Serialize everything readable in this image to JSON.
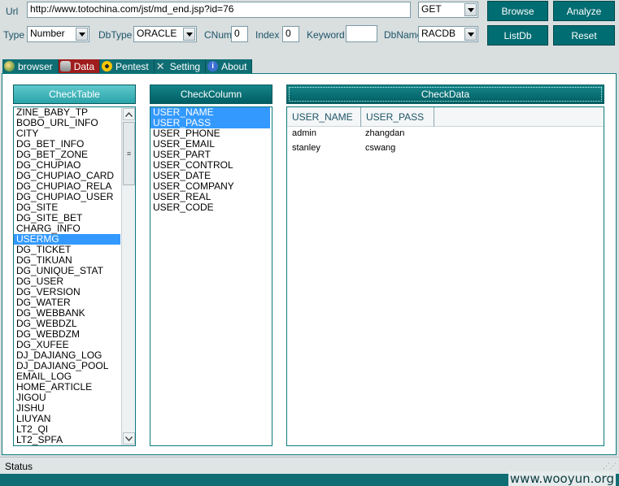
{
  "toolbar": {
    "url_label": "Url",
    "url_value": "http://www.totochina.com/jst/md_end.jsp?id=76",
    "method_value": "GET",
    "browse_label": "Browse",
    "analyze_label": "Analyze",
    "listdb_label": "ListDb",
    "reset_label": "Reset",
    "type_label": "Type",
    "type_value": "Number",
    "dbtype_label": "DbType",
    "dbtype_value": "ORACLE",
    "cnum_label": "CNum",
    "cnum_value": "0",
    "index_label": "Index",
    "index_value": "0",
    "keyword_label": "Keyword",
    "keyword_value": "",
    "dbname_label": "DbName",
    "dbname_value": "RACDB"
  },
  "tabs": [
    {
      "label": "browser",
      "icon": "globe-icon"
    },
    {
      "label": "Data",
      "icon": "database-icon",
      "active": true
    },
    {
      "label": "Pentest",
      "icon": "radiation-icon"
    },
    {
      "label": "Setting",
      "icon": "tools-icon"
    },
    {
      "label": "About",
      "icon": "info-icon"
    }
  ],
  "check_table": {
    "header": "CheckTable",
    "items": [
      "ZINE_BABY_TP",
      "BOBO_URL_INFO",
      "CITY",
      "DG_BET_INFO",
      "DG_BET_ZONE",
      "DG_CHUPIAO",
      "DG_CHUPIAO_CARD",
      "DG_CHUPIAO_RELA",
      "DG_CHUPIAO_USER",
      "DG_SITE",
      "DG_SITE_BET",
      "CHARG_INFO",
      "USERMG",
      "DG_TICKET",
      "DG_TIKUAN",
      "DG_UNIQUE_STAT",
      "DG_USER",
      "DG_VERSION",
      "DG_WATER",
      "DG_WEBBANK",
      "DG_WEBDZL",
      "DG_WEBDZM",
      "DG_XUFEE",
      "DJ_DAJIANG_LOG",
      "DJ_DAJIANG_POOL",
      "EMAIL_LOG",
      "HOME_ARTICLE",
      "JIGOU",
      "JISHU",
      "LIUYAN",
      "LT2_QI",
      "LT2_SPFA"
    ],
    "selected": "USERMG"
  },
  "check_column": {
    "header": "CheckColumn",
    "items": [
      "USER_NAME",
      "USER_PASS",
      "USER_PHONE",
      "USER_EMAIL",
      "USER_PART",
      "USER_CONTROL",
      "USER_DATE",
      "USER_COMPANY",
      "USER_REAL",
      "USER_CODE"
    ],
    "selected": [
      "USER_NAME",
      "USER_PASS"
    ]
  },
  "check_data": {
    "header": "CheckData",
    "columns": [
      "USER_NAME",
      "USER_PASS"
    ],
    "rows": [
      [
        "admin",
        "zhangdan"
      ],
      [
        "stanley",
        "cswang"
      ]
    ]
  },
  "status": {
    "text": "Status"
  },
  "watermark": "www.wooyun.org",
  "colors": {
    "accent": "#006d72",
    "active_tab": "#a01d1d",
    "selection": "#3399ff"
  }
}
